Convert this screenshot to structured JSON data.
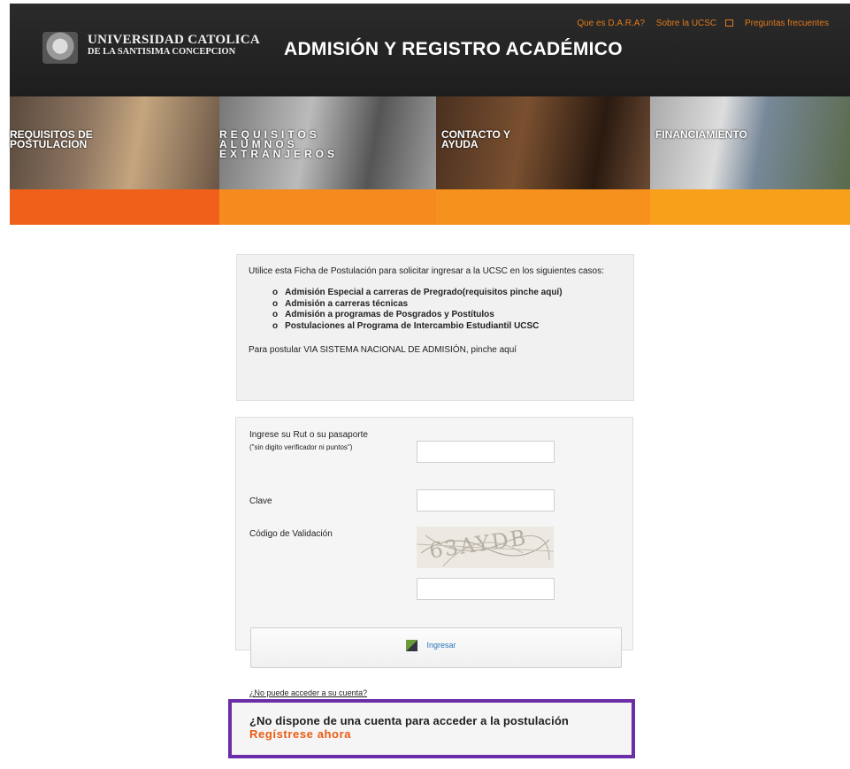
{
  "header": {
    "logo_line1": "UNIVERSIDAD CATOLICA",
    "logo_line2": "DE LA SANTISIMA CONCEPCION",
    "title": "ADMISIÓN Y REGISTRO ACADÉMICO",
    "links": [
      "Que es D.A.R.A?",
      "Sobre la UCSC",
      "Preguntas frecuentes"
    ]
  },
  "banner": {
    "items": [
      {
        "label": "REQUISITOS    DE\nPOSTULACION"
      },
      {
        "label": "REQUISITOS\nALUMNOS\nEXTRANJEROS"
      },
      {
        "label": "CONTACTO Y\nAYUDA"
      },
      {
        "label": "FINANCIAMIENTO"
      }
    ]
  },
  "info": {
    "intro": "Utilice esta Ficha de Postulación para solicitar ingresar a la UCSC en los siguientes casos:",
    "cases": [
      "Admisión Especial a carreras de Pregrado(requisitos pinche aquí)",
      "Admisión a carreras técnicas",
      "Admisión a programas de Posgrados y Postítulos",
      "Postulaciones al Programa de Intercambio Estudiantil UCSC"
    ],
    "footer": "Para postular VIA SISTEMA NACIONAL DE ADMISIÓN, pinche aquí"
  },
  "login": {
    "rut_label": "Ingrese su Rut o su pasaporte",
    "rut_hint": "(\"sin digito verificador ni puntos\")",
    "rut_value": "",
    "clave_label": "Clave",
    "clave_value": "",
    "codigo_label": "Código de Validación",
    "captcha_text": "63AYDB",
    "codigo_value": "",
    "submit_label": "Ingresar",
    "forgot_label": "¿No puede acceder a su cuenta?"
  },
  "register": {
    "question": "¿No dispone de una cuenta para acceder a la postulación",
    "link": "Regístrese ahora"
  },
  "colors": {
    "orange": "#ea5b12",
    "highlight_border": "#6b2da8",
    "link_blue": "#2b76b9"
  }
}
